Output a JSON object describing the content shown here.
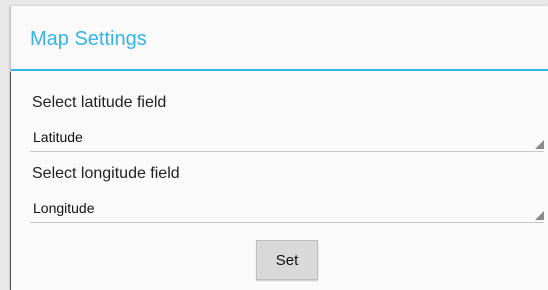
{
  "dialog": {
    "title": "Map Settings",
    "accent_color": "#33b5e5"
  },
  "latitude": {
    "label": "Select latitude field",
    "selected": "Latitude"
  },
  "longitude": {
    "label": "Select longitude field",
    "selected": "Longitude"
  },
  "actions": {
    "set_label": "Set"
  }
}
